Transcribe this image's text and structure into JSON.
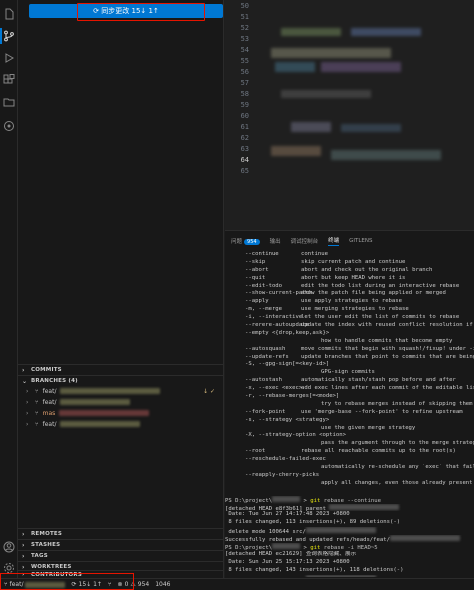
{
  "sidebar": {
    "sync_button": "⟳ 同步更改 15↓ 1↑",
    "sections": {
      "commits": "COMMITS",
      "branches": "BRANCHES (4)",
      "remotes": "REMOTES",
      "stashes": "STASHES",
      "tags": "TAGS",
      "worktrees": "WORKTREES",
      "contributors": "CONTRIBUTORS"
    },
    "branches": [
      {
        "name": "feat/",
        "flags": "↓ ✓"
      },
      {
        "name": "feat/",
        "flags": ""
      },
      {
        "name": "mas",
        "flags": ""
      },
      {
        "name": "feat/",
        "flags": ""
      }
    ]
  },
  "editor": {
    "line_numbers": [
      "50",
      "51",
      "52",
      "53",
      "54",
      "55",
      "56",
      "57",
      "58",
      "59",
      "60",
      "61",
      "62",
      "63",
      "64",
      "65"
    ],
    "current_line": "64"
  },
  "panel": {
    "tabs": [
      "问题",
      "输出",
      "调试控制台",
      "终端",
      "GITLENS"
    ],
    "problems_count": "954",
    "active_tab": "终端"
  },
  "terminal": {
    "options": [
      {
        "opt": "--continue",
        "desc": "continue"
      },
      {
        "opt": "--skip",
        "desc": "skip current patch and continue"
      },
      {
        "opt": "--abort",
        "desc": "abort and check out the original branch"
      },
      {
        "opt": "--quit",
        "desc": "abort but keep HEAD where it is"
      },
      {
        "opt": "--edit-todo",
        "desc": "edit the todo list during an interactive rebase"
      },
      {
        "opt": "--show-current-patch",
        "desc": "show the patch file being applied or merged"
      },
      {
        "opt": "--apply",
        "desc": "use apply strategies to rebase"
      },
      {
        "opt": "-m, --merge",
        "desc": "use merging strategies to rebase"
      },
      {
        "opt": "-i, --interactive",
        "desc": "let the user edit the list of commits to rebase"
      },
      {
        "opt": "--rerere-autoupdate",
        "desc": "update the index with reused conflict resolution if possible"
      },
      {
        "opt": "--empty <{drop,keep,ask}>",
        "desc": ""
      },
      {
        "opt": "",
        "desc": "how to handle commits that become empty"
      },
      {
        "opt": "--autosquash",
        "desc": "move commits that begin with squash!/fixup! under -i"
      },
      {
        "opt": "--update-refs",
        "desc": "update branches that point to commits that are being rebased"
      },
      {
        "opt": "-S, --gpg-sign[=<key-id>]",
        "desc": ""
      },
      {
        "opt": "",
        "desc": "GPG-sign commits"
      },
      {
        "opt": "--autostash",
        "desc": "automatically stash/stash pop before and after"
      },
      {
        "opt": "-x, --exec <exec>",
        "desc": "add exec lines after each commit of the editable list"
      },
      {
        "opt": "-r, --rebase-merges[=<mode>]",
        "desc": ""
      },
      {
        "opt": "",
        "desc": "try to rebase merges instead of skipping them"
      },
      {
        "opt": "--fork-point",
        "desc": "use 'merge-base --fork-point' to refine upstream"
      },
      {
        "opt": "-s, --strategy <strategy>",
        "desc": ""
      },
      {
        "opt": "",
        "desc": "use the given merge strategy"
      },
      {
        "opt": "-X, --strategy-option <option>",
        "desc": ""
      },
      {
        "opt": "",
        "desc": "pass the argument through to the merge strategy"
      },
      {
        "opt": "--root",
        "desc": "rebase all reachable commits up to the root(s)"
      },
      {
        "opt": "--reschedule-failed-exec",
        "desc": ""
      },
      {
        "opt": "",
        "desc": "automatically re-schedule any `exec` that fails"
      },
      {
        "opt": "--reapply-cherry-picks",
        "desc": ""
      },
      {
        "opt": "",
        "desc": "apply all changes, even those already present upstream"
      }
    ],
    "log": [
      {
        "kind": "blank",
        "text": ""
      },
      {
        "kind": "prompt",
        "text": "PS D:\\project\\",
        "cmd": "git",
        "arg": " rebase --continue"
      },
      {
        "kind": "text",
        "text": "[detached HEAD e8f3b61] parent "
      },
      {
        "kind": "text",
        "text": " Date: Tue Jun 27 14:17:48 2023 +0800"
      },
      {
        "kind": "text",
        "text": " 8 files changed, 113 insertions(+), 89 deletions(-)"
      },
      {
        "kind": "text",
        "text": " delete mode 100644 src/"
      },
      {
        "kind": "text",
        "text": "Successfully rebased and updated refs/heads/feat/"
      },
      {
        "kind": "prompt",
        "text": "PS D:\\project\\",
        "cmd": "git",
        "arg": " rebase -i HEAD~5"
      },
      {
        "kind": "text",
        "text": "[detached HEAD ec21629] 查询表格隐藏、展示"
      },
      {
        "kind": "text",
        "text": " Date: Sun Jun 25 15:17:13 2023 +0800"
      },
      {
        "kind": "text",
        "text": " 8 files changed, 143 insertions(+), 118 deletions(-)"
      },
      {
        "kind": "text",
        "text": " delete mode 100644 src/"
      },
      {
        "kind": "text",
        "text": "Successfully rebased and updated refs/heads/feat/"
      },
      {
        "kind": "text",
        "text": "PS D:\\project\\"
      }
    ]
  },
  "statusbar": {
    "branch": "feat/",
    "sync": "15↓ 1↑",
    "errors": "0",
    "warnings": "954",
    "position": "1046"
  }
}
